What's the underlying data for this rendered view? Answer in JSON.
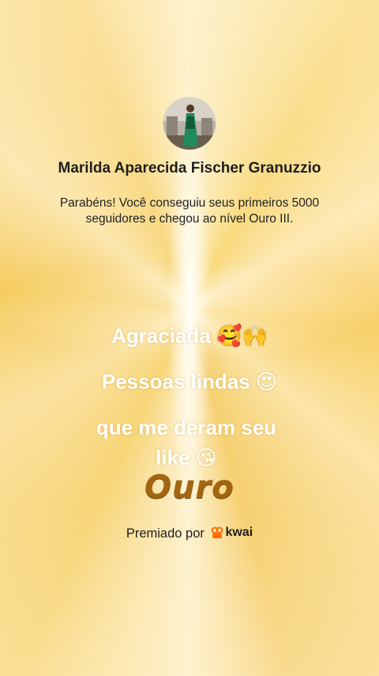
{
  "profile": {
    "name": "Marilda Aparecida Fischer Granuzzio",
    "message": "Parabéns! Você conseguiu seus primeiros 5000 seguidores e chegou ao nível Ouro III."
  },
  "overlay_text": {
    "line1": "Agraciada",
    "line1_emoji": "🥰🙌",
    "line2": "Pessoas lindas",
    "line2_emoji": "😍",
    "line3": "que me deram seu",
    "line4": "like",
    "line4_emoji": "😘"
  },
  "level_badge": "Ouro",
  "award": {
    "label": "Premiado por",
    "brand": "kwai",
    "brand_icon": "kwai-logo-icon",
    "brand_color": "#ff6a00"
  },
  "colors": {
    "gold": "#a3650f",
    "background": "#fbe3a0"
  }
}
